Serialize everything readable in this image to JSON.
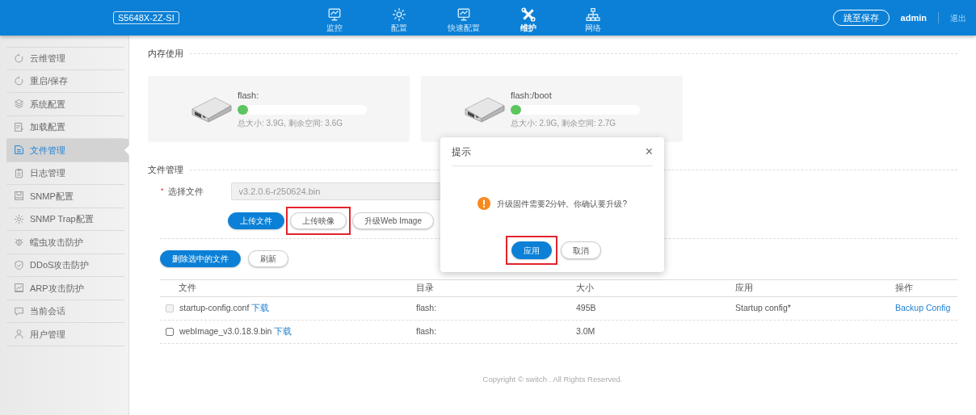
{
  "header": {
    "device": "S5648X-2Z-SI",
    "nav": [
      {
        "label": "监控",
        "kind": "monitor",
        "selected": false
      },
      {
        "label": "配置",
        "kind": "gear",
        "selected": false
      },
      {
        "label": "快速配置",
        "kind": "monitor",
        "selected": false
      },
      {
        "label": "维护",
        "kind": "tools",
        "selected": true
      },
      {
        "label": "网络",
        "kind": "network",
        "selected": false
      }
    ],
    "save_button": "跳至保存",
    "user": "admin",
    "logout": "退出"
  },
  "sidebar": {
    "items": [
      {
        "label": "云维管理",
        "kind": "refresh",
        "selected": false
      },
      {
        "label": "重启/保存",
        "kind": "refresh",
        "selected": false
      },
      {
        "label": "系统配置",
        "kind": "layers",
        "selected": false
      },
      {
        "label": "加载配置",
        "kind": "config",
        "selected": false
      },
      {
        "label": "文件管理",
        "kind": "document",
        "selected": true
      },
      {
        "label": "日志管理",
        "kind": "clipboard",
        "selected": false
      },
      {
        "label": "SNMP配置",
        "kind": "board",
        "selected": false
      },
      {
        "label": "SNMP Trap配置",
        "kind": "gear",
        "selected": false
      },
      {
        "label": "蠕虫攻击防护",
        "kind": "bug",
        "selected": false
      },
      {
        "label": "DDoS攻击防护",
        "kind": "shield",
        "selected": false
      },
      {
        "label": "ARP攻击防护",
        "kind": "frame",
        "selected": false
      },
      {
        "label": "当前会话",
        "kind": "chat",
        "selected": false
      },
      {
        "label": "用户管理",
        "kind": "user",
        "selected": false
      }
    ]
  },
  "memory": {
    "title": "内存使用",
    "disks": [
      {
        "name": "flash:",
        "level": 0.08,
        "summary": "总大小: 3.9G, 剩余空间: 3.6G"
      },
      {
        "name": "flash:/boot",
        "level": 0.08,
        "summary": "总大小: 2.9G, 剩余空间: 2.7G"
      }
    ]
  },
  "files": {
    "title": "文件管理",
    "required_mark": "*",
    "field_label": "选择文件",
    "field_value": "v3.2.0.6-r250624.bin",
    "upload_buttons": [
      {
        "label": "上传文件",
        "primary": true,
        "highlighted": false
      },
      {
        "label": "上传映像",
        "primary": false,
        "highlighted": true
      },
      {
        "label": "升级Web Image",
        "primary": false,
        "highlighted": false
      }
    ],
    "list_buttons": [
      {
        "label": "删除选中的文件",
        "primary": true
      },
      {
        "label": "刷新",
        "primary": false
      }
    ],
    "columns": [
      "文件",
      "目录",
      "大小",
      "应用",
      "操作"
    ],
    "rows": [
      {
        "checked": false,
        "disabled": true,
        "name": "startup-config.conf",
        "link": "下载",
        "directory": "flash:",
        "size": "495B",
        "applied": "Startup config*",
        "action": "Backup Config"
      },
      {
        "checked": false,
        "disabled": false,
        "name": "webImage_v3.0.18.9.bin",
        "link": "下载",
        "directory": "flash:",
        "size": "3.0M"
      }
    ]
  },
  "dialog": {
    "title": "提示",
    "close": "×",
    "message": "升级固件需要2分钟。你确认要升级?",
    "buttons": [
      {
        "label": "应用",
        "primary": true,
        "highlighted": true
      },
      {
        "label": "取消",
        "primary": false,
        "highlighted": false
      }
    ]
  },
  "footer": "Copyright © switch . All Rights Reserved."
}
